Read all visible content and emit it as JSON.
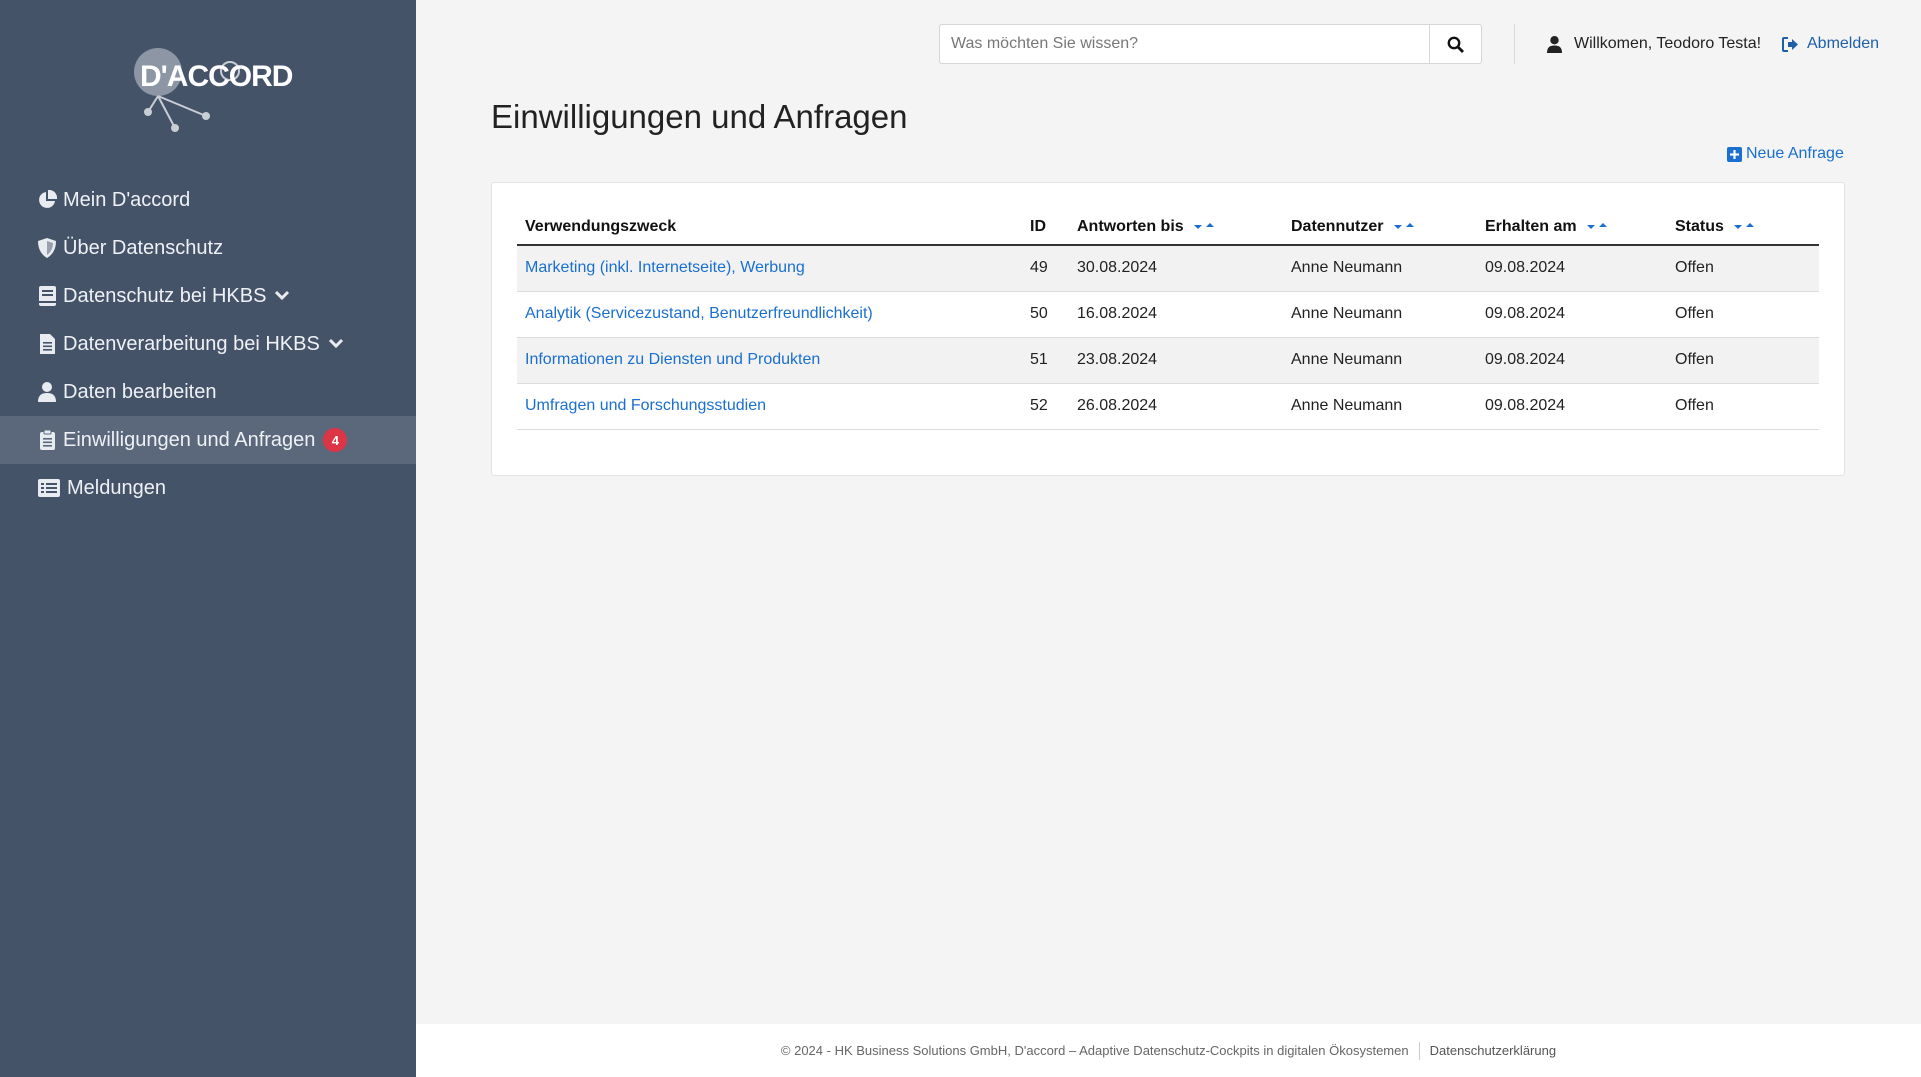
{
  "brand": {
    "logo_text": "D'ACCORD"
  },
  "sidebar": {
    "items": [
      {
        "label": "Mein D'accord",
        "icon": "pie-chart-icon"
      },
      {
        "label": "Über Datenschutz",
        "icon": "shield-icon"
      },
      {
        "label": "Datenschutz bei HKBS",
        "icon": "book-icon",
        "has_submenu": true
      },
      {
        "label": "Datenverarbeitung bei HKBS",
        "icon": "file-icon",
        "has_submenu": true
      },
      {
        "label": "Daten bearbeiten",
        "icon": "user-icon"
      },
      {
        "label": "Einwilligungen und Anfragen",
        "icon": "clipboard-icon",
        "badge": "4",
        "active": true
      },
      {
        "label": "Meldungen",
        "icon": "list-icon"
      }
    ]
  },
  "header": {
    "search_placeholder": "Was möchten Sie wissen?",
    "welcome": "Willkomen, Teodoro Testa!",
    "logout": "Abmelden"
  },
  "main": {
    "title": "Einwilligungen und Anfragen",
    "new_request": "Neue Anfrage",
    "table": {
      "columns": [
        "Verwendungszweck",
        "ID",
        "Antworten bis",
        "Datennutzer",
        "Erhalten am",
        "Status"
      ],
      "rows": [
        [
          "Marketing (inkl. Internetseite), Werbung",
          "49",
          "30.08.2024",
          "Anne Neumann",
          "09.08.2024",
          "Offen"
        ],
        [
          "Analytik (Servicezustand, Benutzerfreundlichkeit)",
          "50",
          "16.08.2024",
          "Anne Neumann",
          "09.08.2024",
          "Offen"
        ],
        [
          "Informationen zu Diensten und Produkten",
          "51",
          "23.08.2024",
          "Anne Neumann",
          "09.08.2024",
          "Offen"
        ],
        [
          "Umfragen und Forschungsstudien",
          "52",
          "26.08.2024",
          "Anne Neumann",
          "09.08.2024",
          "Offen"
        ]
      ]
    }
  },
  "footer": {
    "copyright": "© 2024 - HK Business Solutions GmbH, D'accord – Adaptive Datenschutz-Cockpits in digitalen Ökosystemen",
    "privacy_link": "Datenschutzerklärung"
  },
  "colors": {
    "sidebar": "#455368",
    "sidebar_active": "#5b687b",
    "link": "#1a6fd0",
    "badge": "#dc3545"
  }
}
